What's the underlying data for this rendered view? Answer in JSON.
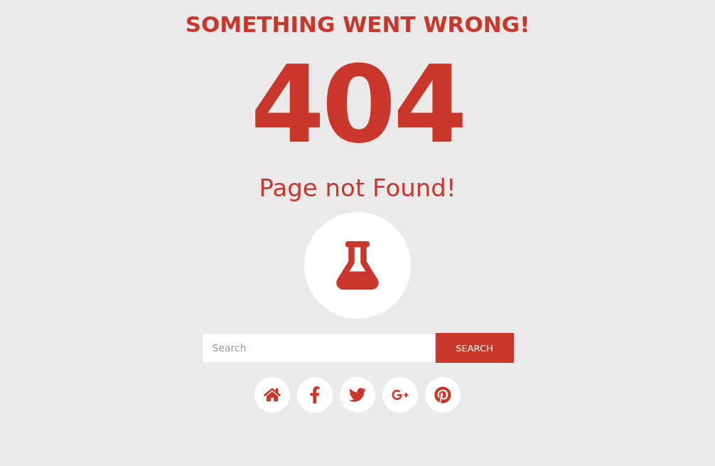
{
  "heading": "SOMETHING WENT WRONG!",
  "error_code": "404",
  "message": "Page not Found!",
  "search": {
    "placeholder": "Search",
    "button": "SEARCH"
  },
  "social_links": [
    {
      "kind": "home"
    },
    {
      "kind": "facebook"
    },
    {
      "kind": "twitter"
    },
    {
      "kind": "googleplus"
    },
    {
      "kind": "pinterest"
    }
  ]
}
